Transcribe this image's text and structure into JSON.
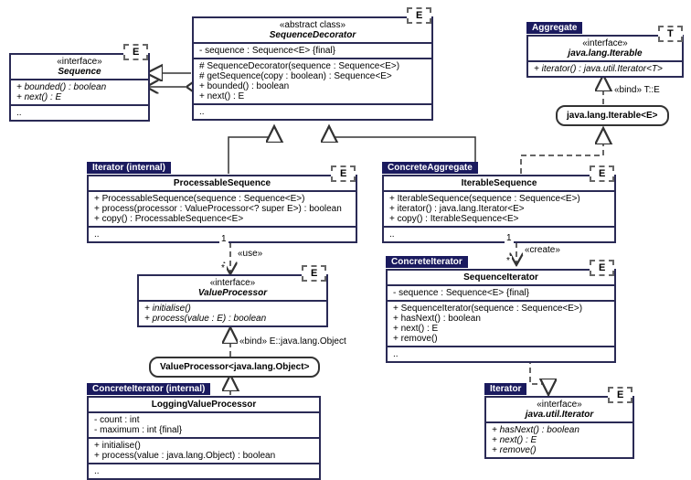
{
  "sequence": {
    "stereotype": "«interface»",
    "name": "Sequence",
    "template": "E",
    "ops": [
      "+ bounded() : boolean",
      "+ next() : E"
    ],
    "extra": ".."
  },
  "seqDecorator": {
    "stereotype": "«abstract class»",
    "name": "SequenceDecorator",
    "template": "E",
    "attrs": [
      "- sequence : Sequence<E>   {final}"
    ],
    "ops": [
      "# SequenceDecorator(sequence : Sequence<E>)",
      "# getSequence(copy : boolean) : Sequence<E>",
      "+ bounded() : boolean",
      "+ next() : E"
    ],
    "extra": ".."
  },
  "iterable": {
    "tag": "Aggregate",
    "stereotype": "«interface»",
    "name": "java.lang.Iterable",
    "template": "T",
    "ops": [
      "+ iterator() : java.util.Iterator<T>"
    ]
  },
  "iterableBound": {
    "bind": "«bind»  T::E",
    "name": "java.lang.Iterable<E>"
  },
  "processable": {
    "tag": "Iterator (internal)",
    "name": "ProcessableSequence",
    "template": "E",
    "ops": [
      "+ ProcessableSequence(sequence : Sequence<E>)",
      "+ process(processor : ValueProcessor<? super E>) : boolean",
      "+ copy() : ProcessableSequence<E>"
    ],
    "extra": ".."
  },
  "iterableSeq": {
    "tag": "ConcreteAggregate",
    "name": "IterableSequence",
    "template": "E",
    "ops": [
      "+ IterableSequence(sequence : Sequence<E>)",
      "+ iterator() : java.lang.Iterator<E>",
      "+ copy() : IterableSequence<E>"
    ],
    "extra": ".."
  },
  "valueProcessor": {
    "stereotype": "«interface»",
    "name": "ValueProcessor",
    "template": "E",
    "ops": [
      "+ initialise()",
      "+ process(value : E) : boolean"
    ]
  },
  "vpBound": {
    "bind": "«bind»  E::java.lang.Object",
    "name": "ValueProcessor<java.lang.Object>"
  },
  "seqIterator": {
    "tag": "ConcreteIterator",
    "name": "SequenceIterator",
    "template": "E",
    "attrs": [
      "- sequence : Sequence<E>   {final}"
    ],
    "ops": [
      "+ SequenceIterator(sequence : Sequence<E>)",
      "+ hasNext() : boolean",
      "+ next() : E",
      "+ remove()"
    ],
    "extra": ".."
  },
  "loggingVP": {
    "tag": "ConcreteIterator (internal)",
    "name": "LoggingValueProcessor",
    "attrs": [
      "- count : int",
      "- maximum : int   {final}"
    ],
    "ops": [
      "+ initialise()",
      "+ process(value : java.lang.Object) : boolean"
    ],
    "extra": ".."
  },
  "javaIterator": {
    "tag": "Iterator",
    "stereotype": "«interface»",
    "name": "java.util.Iterator",
    "template": "E",
    "ops": [
      "+ hasNext() : boolean",
      "+ next() : E",
      "+ remove()"
    ]
  },
  "labels": {
    "use": "«use»",
    "create": "«create»",
    "one_a": "1",
    "one_b": "1",
    "star_a": "*",
    "star_b": "*"
  }
}
